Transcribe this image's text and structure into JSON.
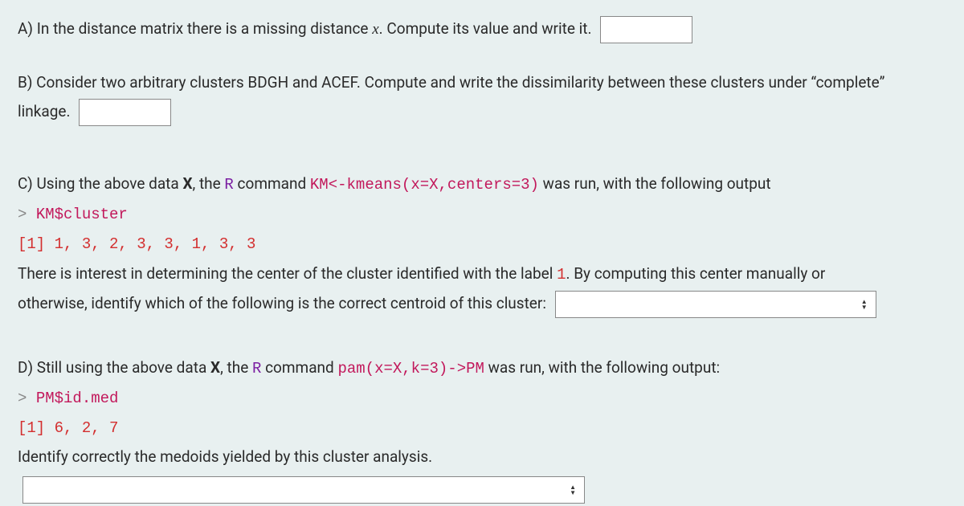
{
  "partA": {
    "prefix": "A) In the distance matrix there is a missing distance ",
    "var": "x",
    "suffix": ". Compute its value and write it."
  },
  "partB": {
    "line1": "B) Consider two arbitrary clusters BDGH and ACEF. Compute and write the dissimilarity between these clusters under “complete”",
    "line2": "linkage."
  },
  "partC": {
    "intro_prefix": "C) Using the above data ",
    "intro_X": "X",
    "intro_mid": ", the ",
    "intro_R": "R",
    "intro_cmd": " command ",
    "code_cmd": "KM<-kmeans(x=X,centers=3)",
    "intro_suffix": " was run, with the following output",
    "prompt_gt": "> ",
    "prompt_code": "KM$cluster",
    "output": "[1] 1, 3, 2, 3, 3, 1, 3, 3",
    "q_line1_pre": "There is interest in determining the center of the cluster identified with the label ",
    "q_line1_label": "1",
    "q_line1_post": ". By computing this center manually or",
    "q_line2": "otherwise, identify which of the following is the correct centroid of this cluster:"
  },
  "partD": {
    "intro_prefix": "D) Still using the above data ",
    "intro_X": "X",
    "intro_mid": ", the ",
    "intro_R": "R",
    "intro_cmd": " command ",
    "code_cmd": "pam(x=X,k=3)->PM",
    "intro_suffix": " was run, with the following output:",
    "prompt_gt": "> ",
    "prompt_code": "PM$id.med",
    "output": "[1] 6, 2, 7",
    "q_line": "Identify correctly the medoids yielded by this cluster analysis."
  }
}
